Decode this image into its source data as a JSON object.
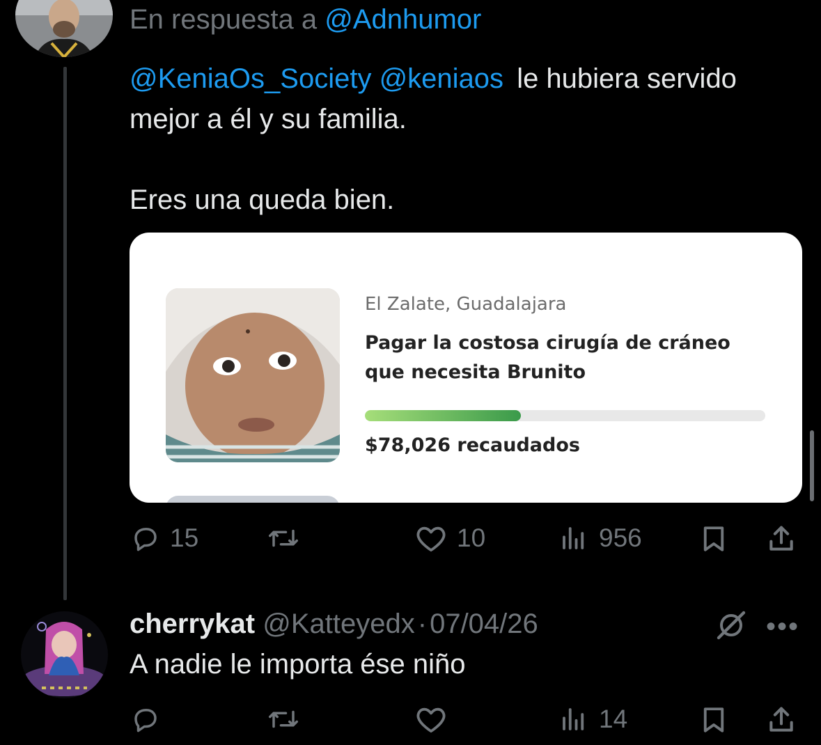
{
  "tweet1": {
    "reply_prefix": "En respuesta a ",
    "reply_handle": "@Adnhumor",
    "mention1": "@KeniaOs_Society",
    "mention2": "@keniaos",
    "text_after_mentions": "le hubiera servido",
    "text_line2": "mejor a él y su familia.",
    "text_line3": "Eres una queda bien.",
    "card": {
      "location": "El Zalate, Guadalajara",
      "title": "Pagar la costosa cirugía de cráneo que necesita Brunito",
      "raised": "$78,026 recaudados",
      "progress_fraction": 0.39,
      "progress_color_start": "#a6de7a",
      "progress_color_end": "#3a9a4a"
    },
    "actions": {
      "replies": "15",
      "likes": "10",
      "views": "956"
    }
  },
  "tweet2": {
    "display_name": "cherrykat",
    "handle": "@Katteyedx",
    "separator": "·",
    "date": "07/04/26",
    "text": "A nadie le importa ése niño",
    "actions": {
      "views": "14"
    }
  },
  "icons": {
    "reply": "speech-bubble-icon",
    "retweet": "retweet-icon",
    "like": "heart-icon",
    "views": "bar-chart-icon",
    "bookmark": "bookmark-icon",
    "share": "share-icon",
    "more": "more-dots-icon",
    "grok": "grok-icon"
  },
  "colors": {
    "background": "#000000",
    "accent": "#1d9bf0",
    "muted": "#71767b",
    "text": "#e7e9ea"
  }
}
